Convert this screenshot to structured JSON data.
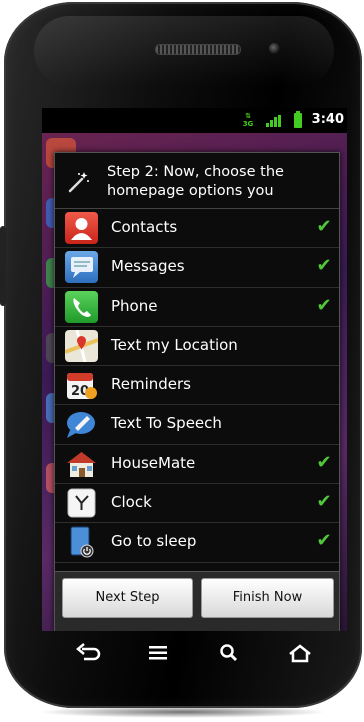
{
  "status_bar": {
    "network": "3G",
    "time": "3:40"
  },
  "dialog": {
    "title": "Step 2: Now, choose the homepage options you",
    "items": [
      {
        "label": "Contacts",
        "checked": true,
        "icon": "contacts-icon"
      },
      {
        "label": "Messages",
        "checked": true,
        "icon": "messages-icon"
      },
      {
        "label": "Phone",
        "checked": true,
        "icon": "phone-icon"
      },
      {
        "label": "Text my Location",
        "checked": false,
        "icon": "map-location-icon"
      },
      {
        "label": "Reminders",
        "checked": false,
        "icon": "calendar-icon"
      },
      {
        "label": "Text To Speech",
        "checked": false,
        "icon": "speech-bubble-icon"
      },
      {
        "label": "HouseMate",
        "checked": true,
        "icon": "house-icon"
      },
      {
        "label": "Clock",
        "checked": true,
        "icon": "clock-icon"
      },
      {
        "label": "Go to sleep",
        "checked": true,
        "icon": "sleep-power-icon"
      }
    ],
    "buttons": {
      "next": "Next Step",
      "finish": "Finish Now"
    }
  },
  "nav": {
    "back": "back-icon",
    "menu": "menu-icon",
    "search": "search-icon",
    "home": "home-icon"
  },
  "colors": {
    "check": "#4fc93a",
    "status_green": "#44cc22"
  }
}
